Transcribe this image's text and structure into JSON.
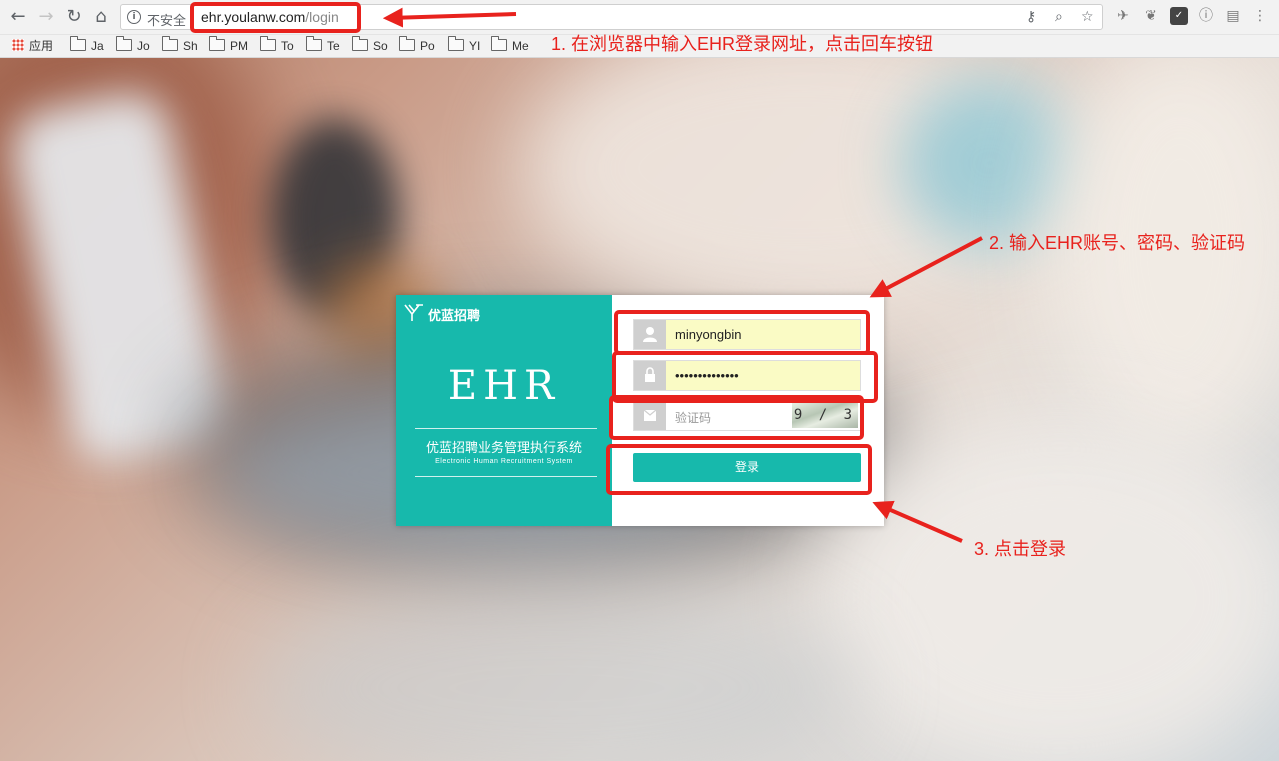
{
  "browser": {
    "security_label": "不安全",
    "url_host": "ehr.youlanw.com",
    "url_path": "/login",
    "bookmarks": [
      {
        "label": "应用",
        "icon": "apps-grid-icon"
      },
      {
        "label": "Ja",
        "icon": "folder-icon"
      },
      {
        "label": "Jo",
        "icon": "folder-icon"
      },
      {
        "label": "Sh",
        "icon": "folder-icon"
      },
      {
        "label": "PM",
        "icon": "folder-icon"
      },
      {
        "label": "To",
        "icon": "folder-icon"
      },
      {
        "label": "Te",
        "icon": "folder-icon"
      },
      {
        "label": "So",
        "icon": "folder-icon"
      },
      {
        "label": "Po",
        "icon": "folder-icon"
      },
      {
        "label": "YI",
        "icon": "folder-icon"
      },
      {
        "label": "Me",
        "icon": "folder-icon"
      }
    ]
  },
  "login": {
    "brand": "优蓝招聘",
    "title": "EHR",
    "system_name": "优蓝招聘业务管理执行系统",
    "system_name_en": "Electronic Human Recruitment System",
    "username": "minyongbin",
    "password_mask": "••••••••••••••",
    "captcha_placeholder": "验证码",
    "captcha_image_text": "9 / 3",
    "submit_label": "登录"
  },
  "annotations": {
    "step1": "1. 在浏览器中输入EHR登录网址，点击回车按钮",
    "step2": "2. 输入EHR账号、密码、验证码",
    "step3": "3. 点击登录"
  },
  "colors": {
    "teal": "#17b9ac",
    "annotation_red": "#e8221d",
    "autofill_yellow": "#fafbc5"
  }
}
